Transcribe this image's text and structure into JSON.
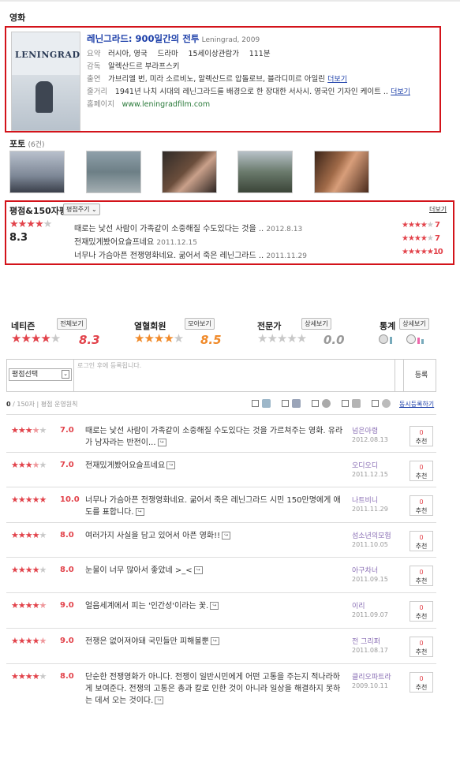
{
  "section_movie": "영화",
  "movie": {
    "poster_text": "LENINGRAD",
    "title": "레닌그라드: 900일간의 전투",
    "original": "Leningrad, 2009",
    "summary_label": "요약",
    "summary_country": "러시아, 영국",
    "summary_genre": "드라마",
    "summary_rating": "15세이상관람가",
    "summary_runtime": "111분",
    "director_label": "감독",
    "director": "알렉산드르 부라프스키",
    "cast_label": "출연",
    "cast": "가브리엘 번, 미라 소르비노, 알렉산드르 압돌로브, 블라디미르 아일린",
    "more": "더보기",
    "plot_label": "줄거리",
    "plot": "1941년 나치 시대의 레닌그라드를 배경으로 한 장대한 서사시. 영국인 기자인 케이트 ..",
    "homepage_label": "홈페이지",
    "homepage": "www.leningradfilm.com"
  },
  "photos": {
    "label": "포토",
    "count": "(6건)"
  },
  "review_summary": {
    "title": "평점&150자평",
    "button": "평점주기",
    "more": "더보기",
    "score": "8.3",
    "items": [
      {
        "text": "때로는 낯선 사람이 가족같이 소중해질 수도있다는 것을 ..",
        "date": "2012.8.13",
        "score": "7"
      },
      {
        "text": "전재밌게봤어요슬프네요",
        "date": "2011.12.15",
        "score": "7"
      },
      {
        "text": "너무나 가슴아픈 전쟁영화네요. 굶어서 죽은 레닌그라드 ..",
        "date": "2011.11.29",
        "score": "10"
      }
    ]
  },
  "categories": [
    {
      "name": "네티즌",
      "button": "전체보기",
      "score": "8.3"
    },
    {
      "name": "열혈회원",
      "button": "모아보기",
      "score": "8.5"
    },
    {
      "name": "전문가",
      "button": "상세보기",
      "score": "0.0"
    },
    {
      "name": "통계",
      "button": "상세보기"
    }
  ],
  "input": {
    "select_label": "평점선택",
    "placeholder": "로그인 후에 등록됩니다.",
    "submit": "등록",
    "counter": "0",
    "counter_max": "/ 150자",
    "policy": "평점 운영원칙",
    "sync": "동시등록하기"
  },
  "reviews": [
    {
      "stars": 3.5,
      "score": "7.0",
      "text": "때로는 낯선 사람이 가족같이 소중해질 수도있다는 것을 가르쳐주는 영화. 유라가 남자라는 반전이...",
      "user": "넘은아령",
      "date": "2012.08.13",
      "rec": "0",
      "rec_label": "추천"
    },
    {
      "stars": 3.5,
      "score": "7.0",
      "text": "전재밌게봤어요슬프네요",
      "user": "오디오디",
      "date": "2011.12.15",
      "rec": "0",
      "rec_label": "추천"
    },
    {
      "stars": 5,
      "score": "10.0",
      "text": "너무나 가슴아픈 전쟁영화네요. 굶어서 죽은 레닌그라드 시민 150만명에게 애도를 표합니다.",
      "user": "나트비니",
      "date": "2011.11.29",
      "rec": "0",
      "rec_label": "추천"
    },
    {
      "stars": 4,
      "score": "8.0",
      "text": "여러가지 사실을 담고 있어서 아픈 영화!!",
      "user": "섬소년의모험",
      "date": "2011.10.05",
      "rec": "0",
      "rec_label": "추천"
    },
    {
      "stars": 4,
      "score": "8.0",
      "text": "눈물이 너무 많아서 좋았네 >_<",
      "user": "아구차너",
      "date": "2011.09.15",
      "rec": "0",
      "rec_label": "추천"
    },
    {
      "stars": 4.5,
      "score": "9.0",
      "text": "얼음세계에서 피는 '인간성'이라는 꽃.",
      "user": "이리",
      "date": "2011.09.07",
      "rec": "0",
      "rec_label": "추천"
    },
    {
      "stars": 4.5,
      "score": "9.0",
      "text": "전쟁은 없어져야돼 국민들만 피해볼뿐",
      "user": "전 그리퍼",
      "date": "2011.08.17",
      "rec": "0",
      "rec_label": "추천"
    },
    {
      "stars": 4,
      "score": "8.0",
      "text": "단순한 전쟁영화가 아니다. 전쟁이 일반시민에게 어떤 고통을 주는지 적나라하게 보여준다. 전쟁의 고통은 총과 칼로 인한 것이 아니라 일상을 해결하지 못하는 데서 오는 것이다.",
      "user": "클리오파트라",
      "date": "2009.10.11",
      "rec": "0",
      "rec_label": "추천"
    }
  ]
}
